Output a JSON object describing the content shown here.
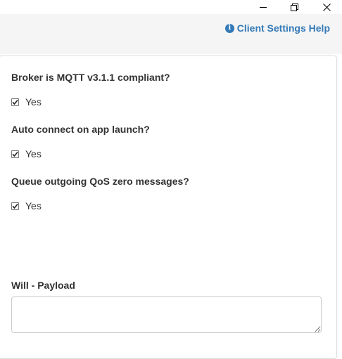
{
  "window_controls": {
    "minimize_icon": "minimize-icon",
    "maximize_icon": "restore-icon",
    "close_icon": "close-icon"
  },
  "header": {
    "help_icon": "info-circle-icon",
    "help_label": "Client Settings Help",
    "accent_color": "#337ab7"
  },
  "settings": [
    {
      "label": "Broker is MQTT v3.1.1 compliant?",
      "checkbox_label": "Yes",
      "checked": true
    },
    {
      "label": "Auto connect on app launch?",
      "checkbox_label": "Yes",
      "checked": true
    },
    {
      "label": "Queue outgoing QoS zero messages?",
      "checkbox_label": "Yes",
      "checked": true
    }
  ],
  "will_payload": {
    "label": "Will - Payload",
    "value": ""
  }
}
